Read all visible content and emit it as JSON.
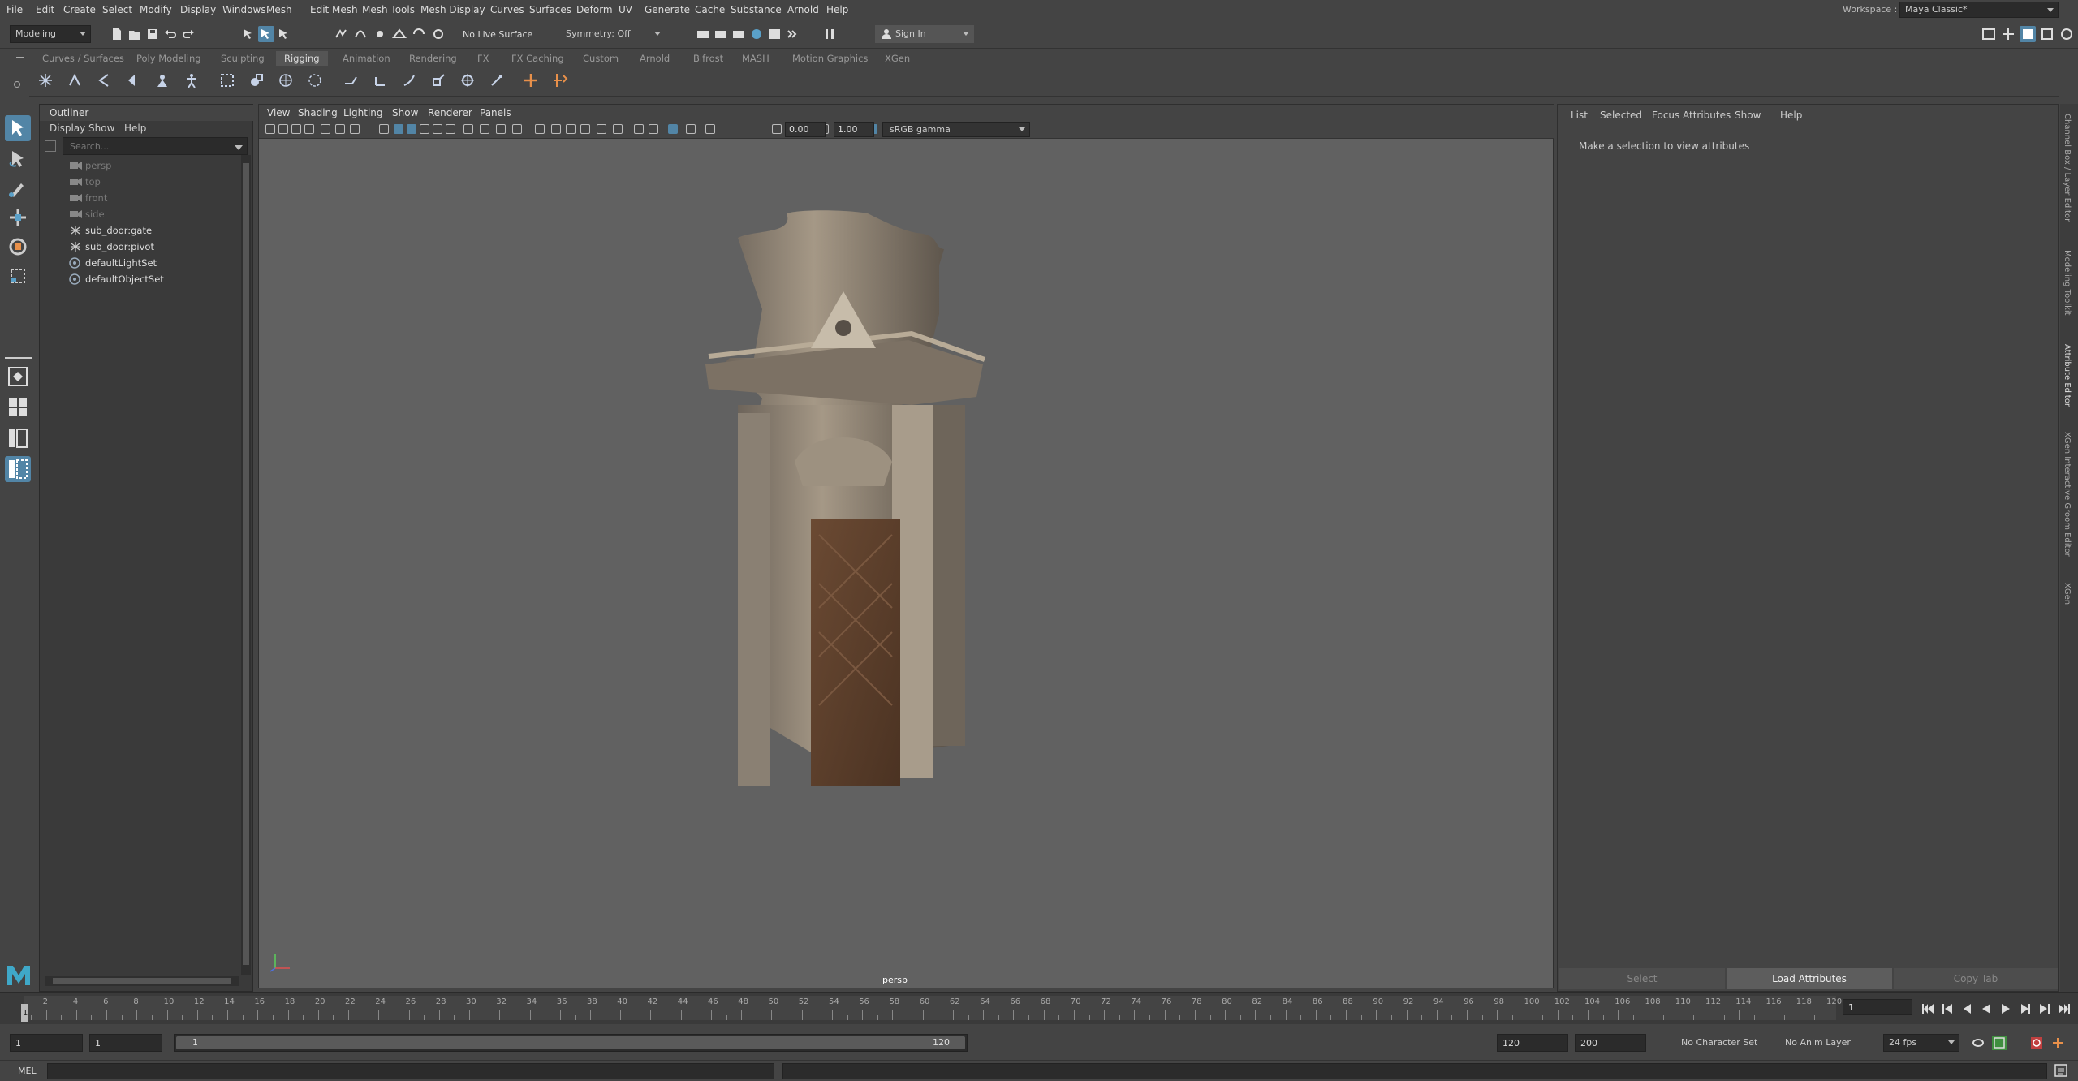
{
  "menu": [
    "File",
    "Edit",
    "Create",
    "Select",
    "Modify",
    "Display",
    "Windows",
    "Mesh",
    "Edit Mesh",
    "Mesh Tools",
    "Mesh Display",
    "Curves",
    "Surfaces",
    "Deform",
    "UV",
    "Generate",
    "Cache",
    "Substance",
    "Arnold",
    "Help"
  ],
  "workspace": {
    "label": "Workspace :",
    "value": "Maya Classic*"
  },
  "status": {
    "mode": "Modeling",
    "live_surface": "No Live Surface",
    "symmetry": "Symmetry: Off",
    "sign_in": "Sign In"
  },
  "shelf_tabs": [
    "Curves / Surfaces",
    "Poly Modeling",
    "Sculpting",
    "Rigging",
    "Animation",
    "Rendering",
    "FX",
    "FX Caching",
    "Custom",
    "Arnold",
    "Bifrost",
    "MASH",
    "Motion Graphics",
    "XGen"
  ],
  "shelf_active": "Rigging",
  "outliner": {
    "title": "Outliner",
    "menu": [
      "Display",
      "Show",
      "Help"
    ],
    "search_placeholder": "Search...",
    "items": [
      {
        "label": "persp",
        "type": "camera",
        "dim": true
      },
      {
        "label": "top",
        "type": "camera",
        "dim": true
      },
      {
        "label": "front",
        "type": "camera",
        "dim": true
      },
      {
        "label": "side",
        "type": "camera",
        "dim": true
      },
      {
        "label": "sub_door:gate",
        "type": "transform",
        "dim": false
      },
      {
        "label": "sub_door:pivot",
        "type": "transform",
        "dim": false
      },
      {
        "label": "defaultLightSet",
        "type": "set",
        "dim": false
      },
      {
        "label": "defaultObjectSet",
        "type": "set",
        "dim": false
      }
    ]
  },
  "viewport": {
    "menu": [
      "View",
      "Shading",
      "Lighting",
      "Show",
      "Renderer",
      "Panels"
    ],
    "exposure": "0.00",
    "gamma": "1.00",
    "color_space": "sRGB gamma",
    "camera_label": "persp"
  },
  "attribute_editor": {
    "menu": [
      "List",
      "Selected",
      "Focus",
      "Attributes",
      "Show",
      "Help"
    ],
    "message": "Make a selection to view attributes",
    "buttons": [
      "Select",
      "Load Attributes",
      "Copy Tab"
    ]
  },
  "side_tabs": [
    "Channel Box / Layer Editor",
    "Modeling Toolkit",
    "Attribute Editor",
    "XGen Interactive Groom Editor",
    "XGen"
  ],
  "timeline": {
    "labels": [
      "2",
      "4",
      "6",
      "8",
      "10",
      "12",
      "14",
      "16",
      "18",
      "20",
      "22",
      "24",
      "26",
      "28",
      "30",
      "32",
      "34",
      "36",
      "38",
      "40",
      "42",
      "44",
      "46",
      "48",
      "50",
      "52",
      "54",
      "56",
      "58",
      "60",
      "62",
      "64",
      "66",
      "68",
      "70",
      "72",
      "74",
      "76",
      "78",
      "80",
      "82",
      "84",
      "86",
      "88",
      "90",
      "92",
      "94",
      "96",
      "98",
      "100",
      "102",
      "104",
      "106",
      "108",
      "110",
      "112",
      "114",
      "116",
      "118",
      "120"
    ],
    "current_frame": "1",
    "frame_field": "1"
  },
  "range": {
    "start": "1",
    "start2": "1",
    "slider_start": "1",
    "slider_end": "120",
    "end": "120",
    "end2": "200",
    "character_set": "No Character Set",
    "anim_layer": "No Anim Layer",
    "fps": "24 fps"
  },
  "command": {
    "lang": "MEL"
  }
}
